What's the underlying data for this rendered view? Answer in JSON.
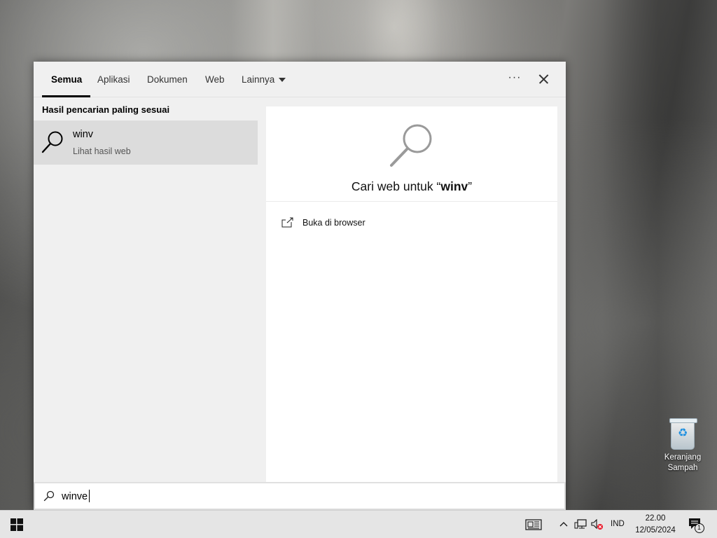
{
  "search": {
    "tabs": [
      {
        "label": "Semua",
        "active": true
      },
      {
        "label": "Aplikasi",
        "active": false
      },
      {
        "label": "Dokumen",
        "active": false
      },
      {
        "label": "Web",
        "active": false
      },
      {
        "label": "Lainnya",
        "active": false
      }
    ],
    "more_icon": "ellipsis-icon",
    "close_icon": "close-icon",
    "best_match_title": "Hasil pencarian paling sesuai",
    "result": {
      "title": "winv",
      "subtitle": "Lihat hasil web",
      "icon": "search-icon"
    },
    "preview": {
      "heading_prefix": "Cari web untuk “",
      "heading_query": "winv",
      "heading_suffix": "”",
      "action_label": "Buka di browser",
      "action_icon": "open-external-icon"
    },
    "input_value": "winve"
  },
  "desktop": {
    "recycle_bin_label_line1": "Keranjang",
    "recycle_bin_label_line2": "Sampah"
  },
  "taskbar": {
    "start_icon": "windows-logo-icon",
    "news_icon": "news-icon",
    "tray_chevron": "chevron-up-icon",
    "network_icon": "network-icon",
    "volume_icon": "volume-muted-icon",
    "language": "IND",
    "time": "22.00",
    "date": "12/05/2024",
    "notifications_icon": "notification-icon",
    "notification_count": "1"
  },
  "colors": {
    "accent": "#0078d7",
    "panel_bg": "#f0f0f0",
    "selected_bg": "#dcdcdc",
    "taskbar_bg": "#e5e5e5"
  }
}
